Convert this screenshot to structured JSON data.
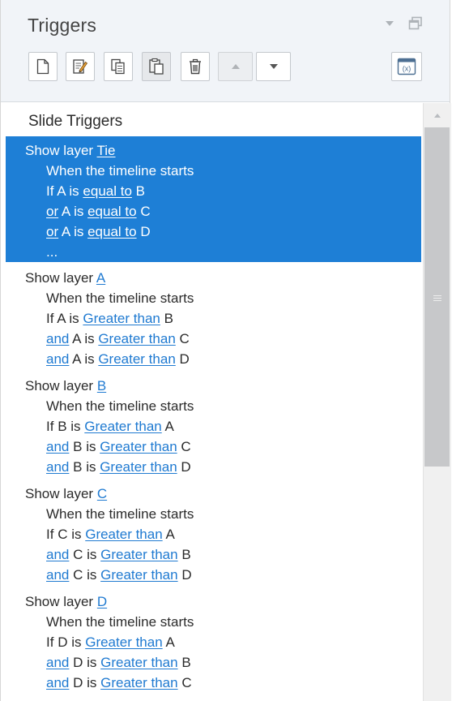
{
  "panel": {
    "title": "Triggers",
    "section_title": "Slide Triggers"
  },
  "toolbar": {
    "buttons": [
      {
        "name": "new-trigger-button",
        "icon": "new-document-icon"
      },
      {
        "name": "edit-trigger-button",
        "icon": "edit-document-icon"
      },
      {
        "name": "copy-trigger-button",
        "icon": "copy-icon"
      },
      {
        "name": "paste-trigger-button",
        "icon": "paste-icon"
      },
      {
        "name": "delete-trigger-button",
        "icon": "trash-icon"
      },
      {
        "name": "move-up-button",
        "icon": "triangle-up-icon"
      },
      {
        "name": "move-down-button",
        "icon": "triangle-down-icon"
      },
      {
        "name": "variables-button",
        "icon": "variables-icon"
      }
    ]
  },
  "triggers": [
    {
      "action": "Show layer",
      "target": "Tie",
      "selected": true,
      "event": "When the timeline starts",
      "conditions": [
        {
          "prefix": "If",
          "prefix_link": false,
          "left": "A",
          "is": "is",
          "op": "equal to",
          "right": "B"
        },
        {
          "prefix": "or",
          "prefix_link": true,
          "left": "A",
          "is": "is",
          "op": "equal to",
          "right": "C"
        },
        {
          "prefix": "or",
          "prefix_link": true,
          "left": "A",
          "is": "is",
          "op": "equal to",
          "right": "D"
        }
      ],
      "more": "..."
    },
    {
      "action": "Show layer",
      "target": "A",
      "selected": false,
      "event": "When the timeline starts",
      "conditions": [
        {
          "prefix": "If",
          "prefix_link": false,
          "left": "A",
          "is": "is",
          "op": "Greater than",
          "right": "B"
        },
        {
          "prefix": "and",
          "prefix_link": true,
          "left": "A",
          "is": "is",
          "op": "Greater than",
          "right": "C"
        },
        {
          "prefix": "and",
          "prefix_link": true,
          "left": "A",
          "is": "is",
          "op": "Greater than",
          "right": "D"
        }
      ]
    },
    {
      "action": "Show layer",
      "target": "B",
      "selected": false,
      "event": "When the timeline starts",
      "conditions": [
        {
          "prefix": "If",
          "prefix_link": false,
          "left": "B",
          "is": "is",
          "op": "Greater than",
          "right": "A"
        },
        {
          "prefix": "and",
          "prefix_link": true,
          "left": "B",
          "is": "is",
          "op": "Greater than",
          "right": "C"
        },
        {
          "prefix": "and",
          "prefix_link": true,
          "left": "B",
          "is": "is",
          "op": "Greater than",
          "right": "D"
        }
      ]
    },
    {
      "action": "Show layer",
      "target": "C",
      "selected": false,
      "event": "When the timeline starts",
      "conditions": [
        {
          "prefix": "If",
          "prefix_link": false,
          "left": "C",
          "is": "is",
          "op": "Greater than",
          "right": "A"
        },
        {
          "prefix": "and",
          "prefix_link": true,
          "left": "C",
          "is": "is",
          "op": "Greater than",
          "right": "B"
        },
        {
          "prefix": "and",
          "prefix_link": true,
          "left": "C",
          "is": "is",
          "op": "Greater than",
          "right": "D"
        }
      ]
    },
    {
      "action": "Show layer",
      "target": "D",
      "selected": false,
      "event": "When the timeline starts",
      "conditions": [
        {
          "prefix": "If",
          "prefix_link": false,
          "left": "D",
          "is": "is",
          "op": "Greater than",
          "right": "A"
        },
        {
          "prefix": "and",
          "prefix_link": true,
          "left": "D",
          "is": "is",
          "op": "Greater than",
          "right": "B"
        },
        {
          "prefix": "and",
          "prefix_link": true,
          "left": "D",
          "is": "is",
          "op": "Greater than",
          "right": "C"
        }
      ]
    }
  ],
  "colors": {
    "selection": "#1e7fd6",
    "link": "#1f7ad1",
    "header_bg": "#f1f4f8"
  }
}
